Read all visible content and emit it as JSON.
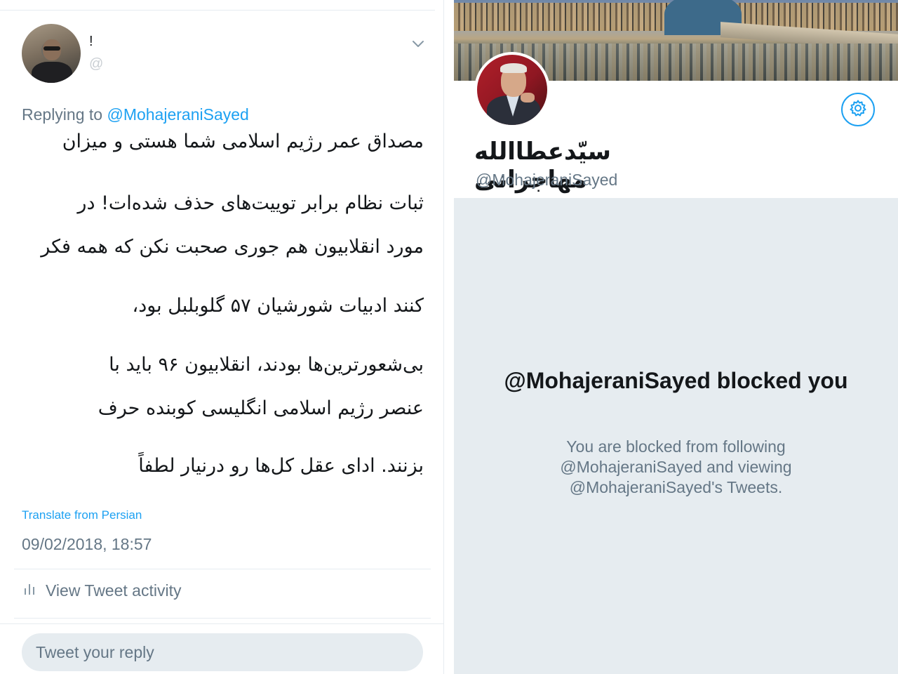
{
  "tweet": {
    "author_name": "!",
    "author_handle": "@",
    "replying_prefix": "Replying to",
    "replying_to": "@MohajeraniSayed",
    "text_paragraphs": [
      "مصداق عمر رژیم اسلامی شما هستی و میزان",
      "ثبات نظام برابر توییت‌های حذف شده‌ات! در",
      "مورد انقلابیون هم جوری صحبت نکن که همه فکر",
      "کنند ادبیات شورشیان ۵۷ گلوبلبل بود،",
      "بی‌شعورترین‌ها بودند، انقلابیون ۹۶ باید با",
      "عنصر رژیم اسلامی انگلیسی کوبنده حرف",
      "بزنند. ادای عقل کل‌ها رو درنیار لطفاً"
    ],
    "translate_label": "Translate from Persian",
    "timestamp": "09/02/2018, 18:57",
    "activity_label": "View Tweet activity",
    "reply_placeholder": "Tweet your reply"
  },
  "profile": {
    "display_name": "سیّدعطاالله مهاجرانی",
    "handle": "@MohajeraniSayed",
    "blocked_title": "@MohajeraniSayed blocked you",
    "blocked_description": "You are blocked from following @MohajeraniSayed and viewing @MohajeraniSayed's Tweets."
  },
  "colors": {
    "accent": "#1da1f2",
    "secondary_text": "#657786",
    "blocked_background": "#e6ecf0"
  },
  "icons": {
    "chevron": "chevron-down-icon",
    "activity": "bar-chart-icon",
    "settings": "gear-icon"
  }
}
